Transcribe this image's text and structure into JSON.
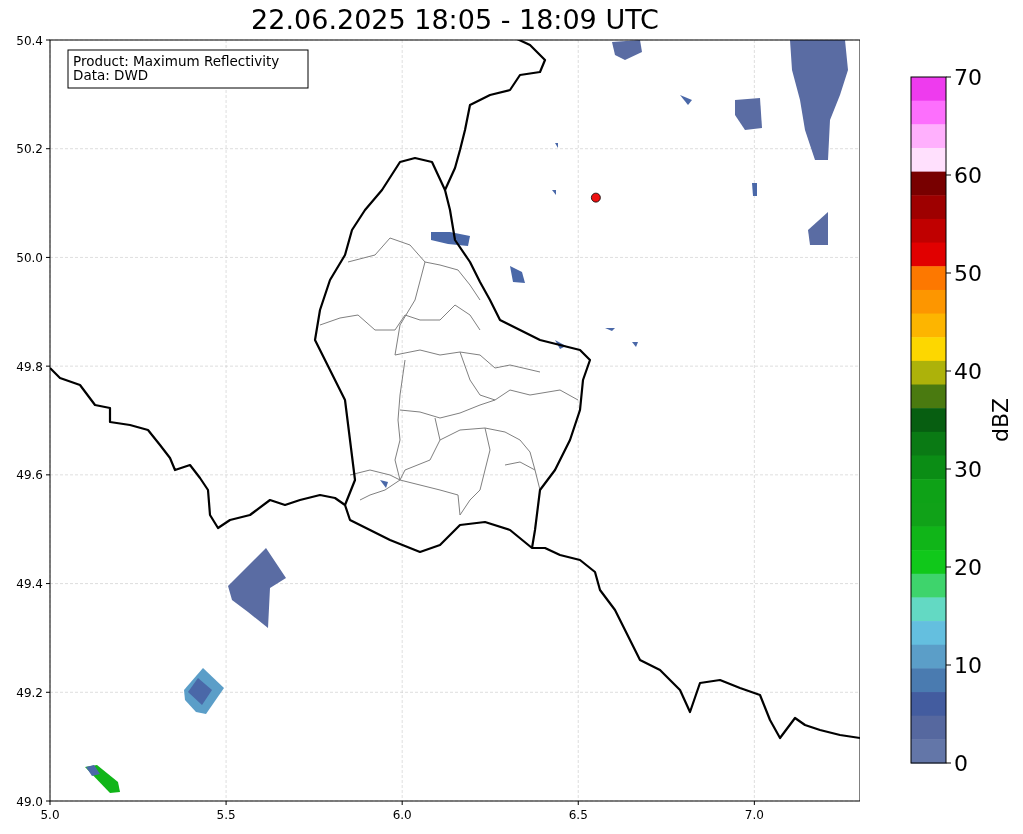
{
  "title": "22.06.2025 18:05 - 18:09 UTC",
  "info_box": {
    "lines": [
      "Product: Maximum Reflectivity",
      "Data: DWD"
    ]
  },
  "map": {
    "chart_data": {
      "type": "scatter",
      "grid": true,
      "x": [
        6.55
      ],
      "series": [
        {
          "color": "#ee1111",
          "values": [
            50.11
          ]
        }
      ],
      "xlim": [
        5.0,
        7.3
      ],
      "ylim": [
        49.0,
        50.4
      ],
      "xticks": [
        {
          "value": 5.0,
          "label": "5.0"
        },
        {
          "value": 5.5,
          "label": "5.5"
        },
        {
          "value": 6.0,
          "label": "6.0"
        },
        {
          "value": 6.5,
          "label": "6.5"
        },
        {
          "value": 7.0,
          "label": "7.0"
        }
      ],
      "yticks": [
        {
          "value": 50.4,
          "label": "50.4"
        },
        {
          "value": 50.2,
          "label": "50.2"
        },
        {
          "value": 50.0,
          "label": "50.0"
        },
        {
          "value": 49.8,
          "label": "49.8"
        },
        {
          "value": 49.6,
          "label": "49.6"
        },
        {
          "value": 49.4,
          "label": "49.4"
        },
        {
          "value": 49.2,
          "label": "49.2"
        },
        {
          "value": 49.0,
          "label": "49.0"
        }
      ]
    }
  },
  "colorbar": {
    "label": "dBZ",
    "ticks": [
      "70",
      "60",
      "50",
      "40",
      "30",
      "20",
      "10",
      "0"
    ],
    "bins": [
      {
        "color": "#ee3bee"
      },
      {
        "color": "#fd6ffd"
      },
      {
        "color": "#ffb0fd"
      },
      {
        "color": "#ffe0fd"
      },
      {
        "color": "#780000"
      },
      {
        "color": "#9e0000"
      },
      {
        "color": "#c00000"
      },
      {
        "color": "#e10000"
      },
      {
        "color": "#fd7800"
      },
      {
        "color": "#fd9600"
      },
      {
        "color": "#fdb500"
      },
      {
        "color": "#fdd700"
      },
      {
        "color": "#adb20a"
      },
      {
        "color": "#4a7a10"
      },
      {
        "color": "#075e11"
      },
      {
        "color": "#0a7a14"
      },
      {
        "color": "#0b8d15"
      },
      {
        "color": "#0ea217"
      },
      {
        "color": "#10a218"
      },
      {
        "color": "#10b518"
      },
      {
        "color": "#10c81a"
      },
      {
        "color": "#3ed46c"
      },
      {
        "color": "#63d9c3"
      },
      {
        "color": "#64bfdf"
      },
      {
        "color": "#5b9ec8"
      },
      {
        "color": "#4a7bb0"
      },
      {
        "color": "#435c9f"
      },
      {
        "color": "#56689f"
      },
      {
        "color": "#6376a8"
      }
    ]
  }
}
